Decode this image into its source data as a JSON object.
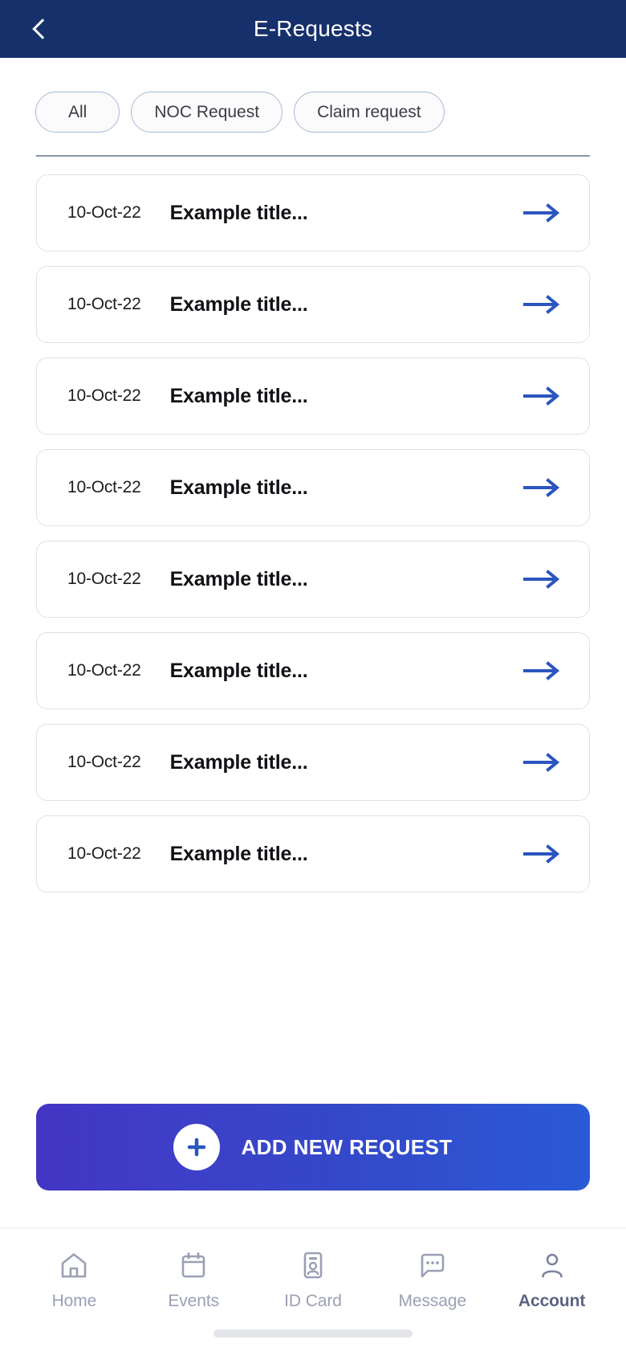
{
  "header": {
    "title": "E-Requests",
    "back_icon": "chevron-left-icon",
    "background_color": "#16306b"
  },
  "filters": {
    "chips": [
      {
        "label": "All",
        "selected": true
      },
      {
        "label": "NOC Request",
        "selected": false
      },
      {
        "label": "Claim request",
        "selected": false
      }
    ]
  },
  "requests": {
    "arrow_icon": "arrow-right-icon",
    "arrow_color": "#2b55bf",
    "items": [
      {
        "date": "10-Oct-22",
        "title": "Example title..."
      },
      {
        "date": "10-Oct-22",
        "title": "Example title..."
      },
      {
        "date": "10-Oct-22",
        "title": "Example title..."
      },
      {
        "date": "10-Oct-22",
        "title": "Example title..."
      },
      {
        "date": "10-Oct-22",
        "title": "Example title..."
      },
      {
        "date": "10-Oct-22",
        "title": "Example title..."
      },
      {
        "date": "10-Oct-22",
        "title": "Example title..."
      },
      {
        "date": "10-Oct-22",
        "title": "Example title..."
      }
    ]
  },
  "cta": {
    "label": "ADD NEW REQUEST",
    "icon": "plus-icon",
    "gradient_start": "#4335c4",
    "gradient_end": "#2a5ad6"
  },
  "bottom_nav": {
    "active": "Account",
    "items": [
      {
        "label": "Home",
        "icon": "home-icon",
        "active": false
      },
      {
        "label": "Events",
        "icon": "calendar-icon",
        "active": false
      },
      {
        "label": "ID Card",
        "icon": "id-card-icon",
        "active": false
      },
      {
        "label": "Message",
        "icon": "message-bubble-icon",
        "active": false
      },
      {
        "label": "Account",
        "icon": "person-icon",
        "active": true
      }
    ]
  }
}
